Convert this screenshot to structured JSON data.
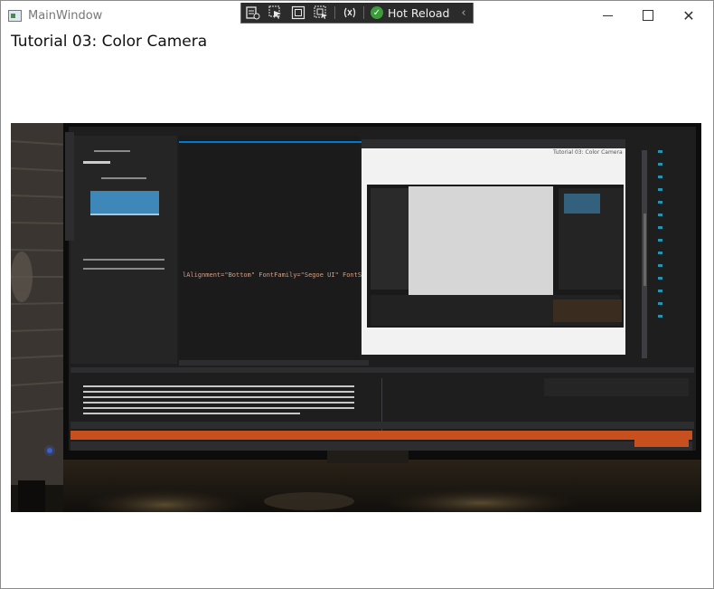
{
  "window": {
    "title": "MainWindow",
    "controls": {
      "minimize_icon": "minimize-icon",
      "maximize_icon": "maximize-icon",
      "close_glyph": "✕"
    }
  },
  "debug_toolbar": {
    "buttons": [
      {
        "icon": "live-visual-tree-icon"
      },
      {
        "icon": "select-element-icon"
      },
      {
        "icon": "display-layout-adorners-icon"
      },
      {
        "icon": "track-focused-element-icon"
      },
      {
        "icon": "binding-failures-icon"
      }
    ],
    "hot_reload_label": "Hot Reload",
    "hot_reload_check": "✓",
    "collapse_glyph": "‹"
  },
  "page": {
    "heading": "Tutorial 03: Color Camera"
  },
  "camera_feed": {
    "description_icon": "color-camera-image",
    "colors": {
      "background": "#151411",
      "monitor": "#1e1e1e",
      "editor": "#1b1b1c",
      "status_bar": "#c8501f",
      "accent": "#007acc"
    }
  }
}
